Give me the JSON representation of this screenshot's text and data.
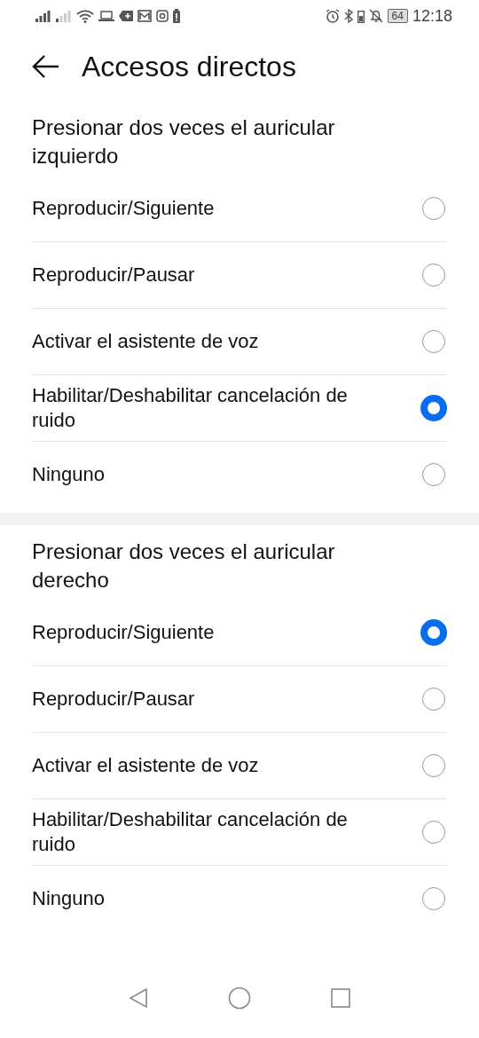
{
  "status_bar": {
    "battery": "64",
    "time": "12:18"
  },
  "header": {
    "title": "Accesos directos"
  },
  "sections": [
    {
      "title": "Presionar dos veces el auricular izquierdo",
      "options": [
        {
          "label": "Reproducir/Siguiente",
          "selected": false
        },
        {
          "label": "Reproducir/Pausar",
          "selected": false
        },
        {
          "label": "Activar el asistente de voz",
          "selected": false
        },
        {
          "label": "Habilitar/Deshabilitar cancelación de ruido",
          "selected": true
        },
        {
          "label": "Ninguno",
          "selected": false
        }
      ]
    },
    {
      "title": "Presionar dos veces el auricular derecho",
      "options": [
        {
          "label": "Reproducir/Siguiente",
          "selected": true
        },
        {
          "label": "Reproducir/Pausar",
          "selected": false
        },
        {
          "label": "Activar el asistente de voz",
          "selected": false
        },
        {
          "label": "Habilitar/Deshabilitar cancelación de ruido",
          "selected": false
        },
        {
          "label": "Ninguno",
          "selected": false
        }
      ]
    }
  ]
}
